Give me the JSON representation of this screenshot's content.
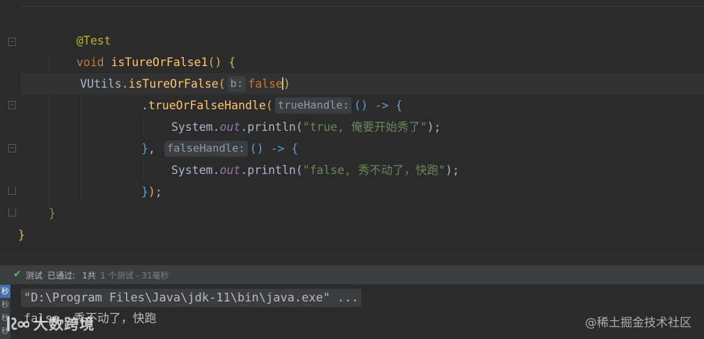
{
  "code": {
    "annotation": "@Test",
    "method_keyword": "void",
    "method_name": "isTureOrFalse1",
    "class_name": "VUtils",
    "call1": "isTureOrFalse",
    "hint_b": "b:",
    "arg_false": "false",
    "call2": "trueOrFalseHandle",
    "hint_true": "trueHandle:",
    "hint_false": "falseHandle:",
    "lambda": "() -> {",
    "system": "System",
    "out": "out",
    "println": "println",
    "string_true": "\"true, 俺要开始秀了\"",
    "string_false": "\"false, 秀不动了，快跑\""
  },
  "test_bar": {
    "label1": "测试",
    "label2": "已通过:",
    "count": "1共",
    "detail": "1 个测试 - 31毫秒"
  },
  "console": {
    "side_tabs": [
      "秒",
      "秒",
      "秒",
      "秒"
    ],
    "command": "\"D:\\Program Files\\Java\\jdk-11\\bin\\java.exe\" ...",
    "output": "false, 秀不动了，快跑"
  },
  "watermarks": {
    "left": "大数跨境",
    "right": "@稀土掘金技术社区"
  },
  "colors": {
    "background": "#2b2b2b",
    "keyword": "#cc7832",
    "function": "#ffc66d",
    "string": "#6a8759",
    "field": "#9876aa",
    "annotation": "#bbb529",
    "pass_green": "#5fb85f"
  }
}
